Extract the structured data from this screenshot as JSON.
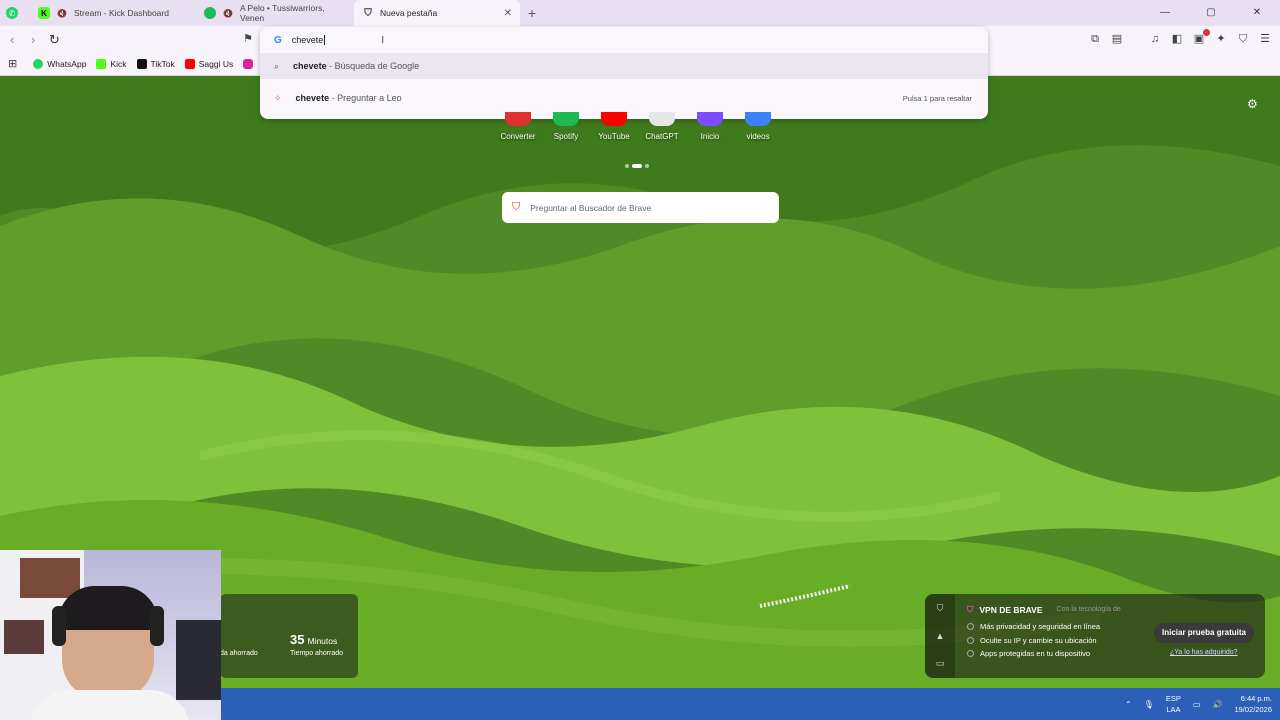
{
  "tabs": [
    {
      "title": "Stream - Kick Dashboard",
      "icon": "kick-icon",
      "color": "#53fc18"
    },
    {
      "title": "A Pelo • Tussiwarriors, Venen",
      "icon": "spotify-icon",
      "color": "#1db954"
    },
    {
      "title": "Nueva pestaña",
      "icon": "brave-shield-icon",
      "active": true
    }
  ],
  "omnibox": {
    "query": "chevete",
    "suggestions": [
      {
        "bold": "chevete",
        "rest": " - Búsqueda de Google",
        "icon": "search-icon"
      },
      {
        "bold": "chevete",
        "rest": " - Preguntar a Leo",
        "icon": "leo-icon",
        "hint": "Pulsa 1 para resaltar"
      }
    ]
  },
  "bookmarks": [
    {
      "label": "WhatsApp",
      "color": "#25d366"
    },
    {
      "label": "Kick",
      "color": "#53fc18"
    },
    {
      "label": "TikTok",
      "color": "#111111"
    },
    {
      "label": "Saggi Us",
      "color": "#ff0000"
    }
  ],
  "top_sites": [
    {
      "label": "Converter",
      "color": "#e03131"
    },
    {
      "label": "Spotify",
      "color": "#1db954"
    },
    {
      "label": "YouTube",
      "color": "#ff0000"
    },
    {
      "label": "ChatGPT",
      "color": "#10a37f"
    },
    {
      "label": "Inicio",
      "color": "#7c4dff"
    },
    {
      "label": "videos",
      "color": "#3b82f6"
    }
  ],
  "brave_search": {
    "placeholder": "Preguntar al Buscador de Brave"
  },
  "stats": {
    "minutes_value": "35",
    "minutes_unit": "Minutos",
    "left_caption": "da ahorrado",
    "right_caption": "Tiempo ahorrado"
  },
  "vpn": {
    "title": "VPN DE BRAVE",
    "powered_by": "Con la tecnología de",
    "features": [
      "Más privacidad y seguridad en línea",
      "Oculte su IP y cambie su ubicación",
      "Apps protegidas en tu dispositivo"
    ],
    "cta": "Iniciar prueba gratuita",
    "already": "¿Ya lo has adquirido?"
  },
  "taskbar": {
    "lang_top": "ESP",
    "lang_bottom": "LAA",
    "time": "6:44 p.m.",
    "date": "19/02/2026"
  },
  "window_controls": {
    "minimize": "—",
    "maximize": "▢",
    "close": "✕"
  }
}
